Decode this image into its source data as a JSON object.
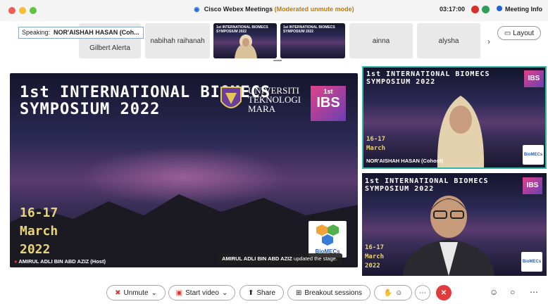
{
  "window": {
    "app_name": "Cisco Webex Meetings",
    "mode": "(Moderated unmute mode)",
    "clock": "03:17:00",
    "meeting_info": "Meeting Info"
  },
  "speaking": {
    "label": "Speaking:",
    "name": "NOR'AISHAH HASAN (Coh..."
  },
  "strip": {
    "tiles": [
      "Gilbert Alerta",
      "nabihah raihanah",
      "ainna",
      "alysha"
    ],
    "layout_label": "Layout"
  },
  "slide": {
    "title_line1": "1st INTERNATIONAL BIOMECS",
    "title_line2": "SYMPOSIUM 2022",
    "dates_line1": "16-17",
    "dates_line2": "March",
    "dates_line3": "2022",
    "uni_line1": "UNIVERSITI",
    "uni_line2": "TEKNOLOGI",
    "uni_line3": "MARA",
    "ibs_top": "1st",
    "ibs_main": "IBS",
    "biomecs_logo": "BioMECs"
  },
  "stage": {
    "presenter": "AMIRUL ADLI BIN ABD AZIZ  (Host)",
    "toast_name": "AMIRUL ADLI BIN ABD AZIZ",
    "toast_text": " updated the stage."
  },
  "right1": {
    "name": "NOR'AISHAH HASAN  (Cohost)"
  },
  "controls": {
    "unmute": "Unmute",
    "start_video": "Start video",
    "share": "Share",
    "breakout": "Breakout sessions"
  },
  "colors": {
    "accent": "#35b6a6",
    "leave": "#e23b3b",
    "brand": "#1f63d6"
  }
}
